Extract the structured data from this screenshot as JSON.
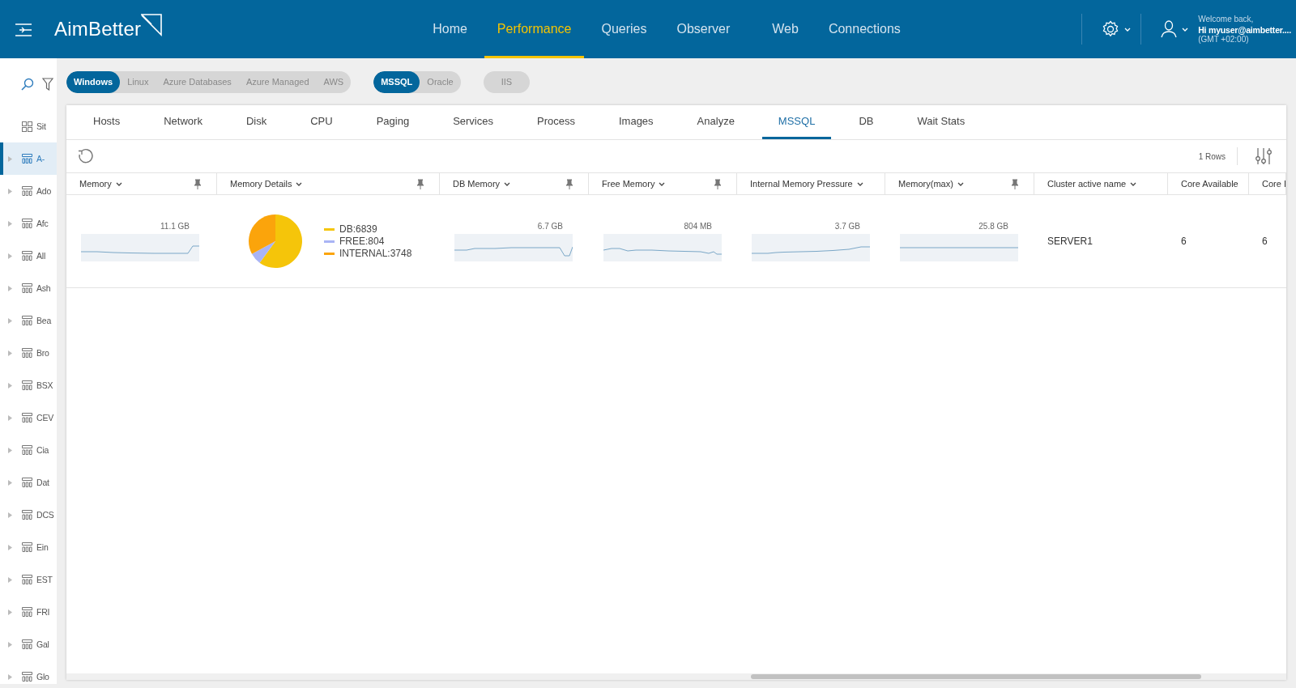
{
  "header": {
    "logo": "AimBetter",
    "nav": [
      {
        "label": "Home",
        "selected": false
      },
      {
        "label": "Performance",
        "selected": true
      },
      {
        "label": "Queries",
        "selected": false
      },
      {
        "label": "Observer",
        "selected": false
      },
      {
        "label": "Web",
        "selected": false
      },
      {
        "label": "Connections",
        "selected": false
      }
    ],
    "user": {
      "greeting": "Welcome back,",
      "name": "Hi myuser@aimbetter....",
      "timezone": "(GMT +02:00)"
    }
  },
  "sidebar": {
    "items": [
      {
        "kind": "site",
        "label": "Sit",
        "selected": false
      },
      {
        "kind": "server",
        "label": "A-",
        "selected": true
      },
      {
        "kind": "server",
        "label": "Ado",
        "selected": false
      },
      {
        "kind": "server",
        "label": "Afc",
        "selected": false
      },
      {
        "kind": "server",
        "label": "All",
        "selected": false
      },
      {
        "kind": "server",
        "label": "Ash",
        "selected": false
      },
      {
        "kind": "server",
        "label": "Bea",
        "selected": false
      },
      {
        "kind": "server",
        "label": "Bro",
        "selected": false
      },
      {
        "kind": "server",
        "label": "BSX",
        "selected": false
      },
      {
        "kind": "server",
        "label": "CEV",
        "selected": false
      },
      {
        "kind": "server",
        "label": "Cia",
        "selected": false
      },
      {
        "kind": "server",
        "label": "Dat",
        "selected": false
      },
      {
        "kind": "server",
        "label": "DCS",
        "selected": false
      },
      {
        "kind": "server",
        "label": "Ein",
        "selected": false
      },
      {
        "kind": "server",
        "label": "EST",
        "selected": false
      },
      {
        "kind": "server",
        "label": "FRI",
        "selected": false
      },
      {
        "kind": "server",
        "label": "Gal",
        "selected": false
      },
      {
        "kind": "server",
        "label": "Glo",
        "selected": false
      }
    ]
  },
  "filters": [
    [
      {
        "label": "Windows",
        "selected": true
      },
      {
        "label": "Linux",
        "selected": false
      },
      {
        "label": "Azure Databases",
        "selected": false
      },
      {
        "label": "Azure Managed",
        "selected": false
      },
      {
        "label": "AWS",
        "selected": false
      }
    ],
    [
      {
        "label": "MSSQL",
        "selected": true
      },
      {
        "label": "Oracle",
        "selected": false
      }
    ],
    [
      {
        "label": "IIS",
        "selected": false
      }
    ]
  ],
  "tabs": [
    {
      "label": "Hosts",
      "selected": false
    },
    {
      "label": "Network",
      "selected": false
    },
    {
      "label": "Disk",
      "selected": false
    },
    {
      "label": "CPU",
      "selected": false
    },
    {
      "label": "Paging",
      "selected": false
    },
    {
      "label": "Services",
      "selected": false
    },
    {
      "label": "Process",
      "selected": false
    },
    {
      "label": "Images",
      "selected": false
    },
    {
      "label": "Analyze",
      "selected": false
    },
    {
      "label": "MSSQL",
      "selected": true
    },
    {
      "label": "DB",
      "selected": false
    },
    {
      "label": "Wait Stats",
      "selected": false
    }
  ],
  "toolbar": {
    "row_count": "1 Rows"
  },
  "table": {
    "columns": [
      {
        "label": "Memory",
        "dropdown": true,
        "pinned": true
      },
      {
        "label": "Memory Details",
        "dropdown": true,
        "pinned": true
      },
      {
        "label": "DB Memory",
        "dropdown": true,
        "pinned": true
      },
      {
        "label": "Free Memory",
        "dropdown": true,
        "pinned": true
      },
      {
        "label": "Internal Memory Pressure",
        "dropdown": true,
        "pinned": false
      },
      {
        "label": "Memory(max)",
        "dropdown": true,
        "pinned": true
      },
      {
        "label": "Cluster active name",
        "dropdown": true,
        "pinned": false
      },
      {
        "label": "Core Available"
      },
      {
        "label": "Core I"
      }
    ],
    "rows": [
      {
        "cells": [
          {
            "kind": "sparkline",
            "value": "11.1 GB"
          },
          {
            "kind": "pie",
            "legend": [
              {
                "color": "#f5c50a"
              },
              {
                "color": "#a9b4f5"
              },
              {
                "color": "#fba40b"
              }
            ],
            "chart_data": {
              "type": "pie",
              "categories": [
                "DB:6839",
                "FREE:804",
                "INTERNAL:3748"
              ],
              "values": [
                6839,
                804,
                3748
              ]
            }
          },
          {
            "kind": "sparkline",
            "value": "6.7 GB"
          },
          {
            "kind": "sparkline",
            "value": "804 MB"
          },
          {
            "kind": "sparkline",
            "value": "3.7 GB"
          },
          {
            "kind": "sparkline",
            "value": "25.8 GB"
          },
          {
            "kind": "text",
            "value": "SERVER1"
          },
          {
            "kind": "text",
            "value": "6"
          },
          {
            "kind": "text",
            "value": "6"
          }
        ]
      }
    ]
  }
}
